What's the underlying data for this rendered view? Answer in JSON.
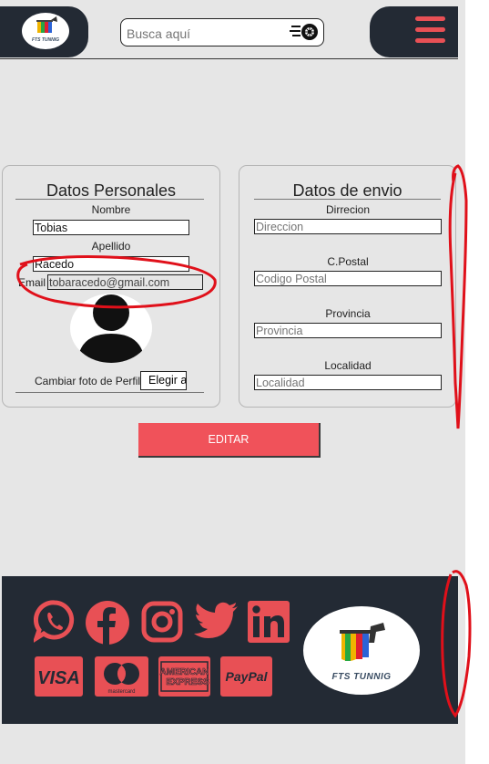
{
  "header": {
    "search_placeholder": "Busca aquí"
  },
  "personal": {
    "title": "Datos Personales",
    "name_label": "Nombre",
    "name_value": "Tobias",
    "surname_label": "Apellido",
    "surname_value": "Racedo",
    "email_label": "Email",
    "email_value": "tobaracedo@gmail.com",
    "photo_label": "Cambiar foto de Perfil",
    "file_button": "Elegir a"
  },
  "shipping": {
    "title": "Datos de envio",
    "address_label": "Dirrecion",
    "address_placeholder": "Direccion",
    "postal_label": "C.Postal",
    "postal_placeholder": "Codigo Postal",
    "province_label": "Provincia",
    "province_placeholder": "Provincia",
    "locality_label": "Localidad",
    "locality_placeholder": "Localidad"
  },
  "edit_button": "EDITAR",
  "footer": {
    "social_icons": [
      "whatsapp-icon",
      "facebook-icon",
      "instagram-icon",
      "twitter-icon",
      "linkedin-icon"
    ],
    "payment_icons": [
      "visa-icon",
      "mastercard-icon",
      "american-express-icon",
      "paypal-icon"
    ],
    "visa": "VISA",
    "mastercard": "mastercard",
    "amex_line1": "AMERICAN",
    "amex_line2": "EXPRESS",
    "paypal": "PayPal",
    "brand": "FTS TUNNIG"
  },
  "colors": {
    "dark": "#232a34",
    "accent": "#e85055",
    "annotation": "#e0101a"
  }
}
